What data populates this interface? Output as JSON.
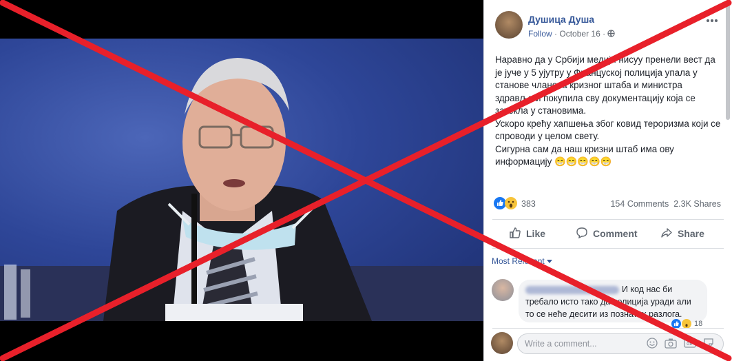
{
  "post": {
    "author": "Душица Душа",
    "follow_label": "Follow",
    "separator": "·",
    "date": "October 16",
    "text": "Наравно да у Србији медији нисуу пренели вест да је јуче у 5 ујутру у Француској полиција упала у станове чланова кризног штаба и министра здравља и покупила сву документацију која се затекла у становима.\nУскоро крећу хапшења због ковид тероризма који се спроводи у целом свету.\nСигурна сам да наш кризни штаб има ову информацију 😁😁😁😁😁",
    "reaction_count": "383",
    "comments_count": "154 Comments",
    "shares_count": "2.3K Shares"
  },
  "actions": {
    "like": "Like",
    "comment": "Comment",
    "share": "Share"
  },
  "comments": {
    "sort_label": "Most Relevant",
    "first": {
      "text": "И код нас би требало исто тако да полиција уради али то се неће десити из познатих разлога.",
      "reaction_count": "18"
    },
    "write_placeholder": "Write a comment..."
  },
  "icons": [
    "globe-icon",
    "more-options-icon",
    "like-reaction-icon",
    "wow-reaction-icon",
    "like-icon",
    "comment-icon",
    "share-icon",
    "dropdown-caret-icon",
    "emoji-icon",
    "camera-icon",
    "gif-icon",
    "sticker-icon"
  ],
  "colors": {
    "link": "#365899",
    "cross": "#e8202a",
    "like_blue": "#1877f2"
  }
}
